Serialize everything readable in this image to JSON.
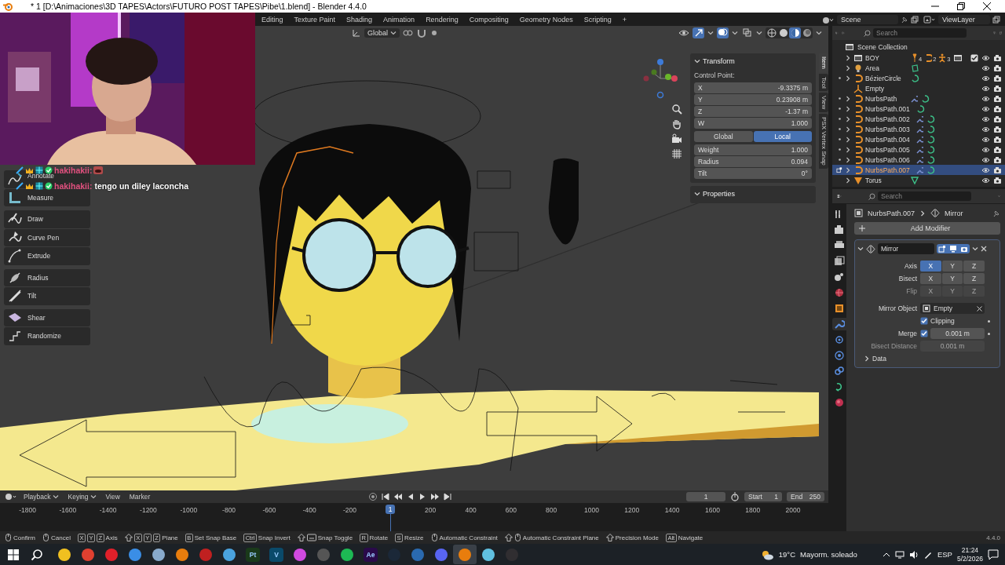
{
  "window": {
    "title": "* 1 [D:\\Animaciones\\3D TAPES\\Actors\\FUTURO POST TAPES\\Pibe\\1.blend] - Blender 4.4.0"
  },
  "workspaces": {
    "tabs": [
      {
        "label": "Editing",
        "selected": false
      },
      {
        "label": "Texture Paint",
        "selected": false
      },
      {
        "label": "Shading",
        "selected": false
      },
      {
        "label": "Animation",
        "selected": false
      },
      {
        "label": "Rendering",
        "selected": false
      },
      {
        "label": "Compositing",
        "selected": false
      },
      {
        "label": "Geometry Nodes",
        "selected": false
      },
      {
        "label": "Scripting",
        "selected": false
      }
    ],
    "add": "+"
  },
  "scene": {
    "name": "Scene"
  },
  "view_layer": {
    "name": "ViewLayer"
  },
  "chat": [
    {
      "user": "hakihakii:",
      "kind": "emote"
    },
    {
      "user": "hakihakii:",
      "kind": "text",
      "message": "tengo un diley laconcha"
    }
  ],
  "viewport": {
    "orientation": "Global",
    "toggles": [
      {
        "kind": "gizmo",
        "on": true
      },
      {
        "kind": "overlay",
        "on": true
      },
      {
        "kind": "xray",
        "on": false
      }
    ],
    "shading": [
      {
        "kind": "wireframe",
        "selected": false
      },
      {
        "kind": "solid",
        "selected": false
      },
      {
        "kind": "material",
        "selected": true
      },
      {
        "kind": "rendered",
        "selected": false
      }
    ],
    "tool_groups": [
      {
        "tools": [
          {
            "label": "Annotate"
          },
          {
            "label": "Measure"
          }
        ]
      },
      {
        "tools": [
          {
            "label": "Draw"
          },
          {
            "label": "Curve Pen"
          },
          {
            "label": "Extrude"
          }
        ]
      },
      {
        "tools": [
          {
            "label": "Radius"
          },
          {
            "label": "Tilt"
          }
        ]
      },
      {
        "tools": [
          {
            "label": "Shear"
          },
          {
            "label": "Randomize"
          }
        ]
      }
    ],
    "sidebar": {
      "tabs": [
        {
          "label": "Item",
          "selected": true
        },
        {
          "label": "Tool",
          "selected": false
        },
        {
          "label": "View",
          "selected": false
        },
        {
          "label": "PSX Vertex Snap",
          "selected": false
        }
      ],
      "panels": [
        {
          "title": "Transform",
          "expanded": true,
          "subtitle": "Control Point:",
          "rows": [
            {
              "kind": "field",
              "label": "X",
              "value": "-9.3375 m"
            },
            {
              "kind": "field",
              "label": "Y",
              "value": "0.23908 m"
            },
            {
              "kind": "field",
              "label": "Z",
              "value": "-1.37 m"
            },
            {
              "kind": "field",
              "label": "W",
              "value": "1.000"
            },
            {
              "kind": "toggle",
              "options": [
                {
                  "label": "Global",
                  "selected": false
                },
                {
                  "label": "Local",
                  "selected": true
                }
              ]
            },
            {
              "kind": "field",
              "label": "Weight",
              "value": "1.000"
            },
            {
              "kind": "field",
              "label": "Radius",
              "value": "0.094"
            },
            {
              "kind": "field",
              "label": "Tilt",
              "value": "0°"
            }
          ]
        },
        {
          "title": "Properties",
          "expanded": true
        }
      ]
    }
  },
  "timeline": {
    "menus": [
      "Playback",
      "Keying",
      "View",
      "Marker"
    ],
    "frame": "1",
    "start_label": "Start",
    "start": "1",
    "end_label": "End",
    "end": "250",
    "playhead": "1",
    "ticks": [
      "-1800",
      "-1600",
      "-1400",
      "-1200",
      "-1000",
      "-800",
      "-600",
      "-400",
      "-200",
      "200",
      "400",
      "600",
      "800",
      "1000",
      "1200",
      "1400",
      "1600",
      "1800",
      "2000"
    ]
  },
  "outliner": {
    "search_placeholder": "Search",
    "root": "Scene Collection",
    "items": [
      {
        "name": "BOY",
        "kind": "collection",
        "selected": false,
        "has_modifier": false,
        "counts": [
          "4",
          "2",
          "3"
        ],
        "checked": true
      },
      {
        "name": "Area",
        "kind": "light",
        "selected": false,
        "has_modifier": false
      },
      {
        "name": "BézierCircle",
        "kind": "curve",
        "selected": false,
        "has_modifier": false
      },
      {
        "name": "Empty",
        "kind": "empty",
        "selected": false,
        "has_modifier": false
      },
      {
        "name": "NurbsPath",
        "kind": "curve",
        "selected": false,
        "has_modifier": true
      },
      {
        "name": "NurbsPath.001",
        "kind": "curve",
        "selected": false,
        "has_modifier": false
      },
      {
        "name": "NurbsPath.002",
        "kind": "curve",
        "selected": false,
        "has_modifier": true
      },
      {
        "name": "NurbsPath.003",
        "kind": "curve",
        "selected": false,
        "has_modifier": true
      },
      {
        "name": "NurbsPath.004",
        "kind": "curve",
        "selected": false,
        "has_modifier": true
      },
      {
        "name": "NurbsPath.005",
        "kind": "curve",
        "selected": false,
        "has_modifier": true
      },
      {
        "name": "NurbsPath.006",
        "kind": "curve",
        "selected": false,
        "has_modifier": true
      },
      {
        "name": "NurbsPath.007",
        "kind": "curve",
        "selected": true,
        "has_modifier": true
      },
      {
        "name": "Torus",
        "kind": "mesh",
        "selected": false,
        "has_modifier": false
      }
    ]
  },
  "properties": {
    "search_placeholder": "Search",
    "tabs": [
      {
        "kind": "tool",
        "selected": false
      },
      {
        "kind": "render",
        "selected": false
      },
      {
        "kind": "output",
        "selected": false
      },
      {
        "kind": "view_layer",
        "selected": false
      },
      {
        "kind": "scene",
        "selected": false
      },
      {
        "kind": "world",
        "selected": false
      },
      {
        "kind": "object",
        "selected": false
      },
      {
        "kind": "modifier",
        "selected": true
      },
      {
        "kind": "particles",
        "selected": false
      },
      {
        "kind": "physics",
        "selected": false
      },
      {
        "kind": "constraints",
        "selected": false
      },
      {
        "kind": "data",
        "selected": false
      },
      {
        "kind": "material",
        "selected": false
      }
    ],
    "breadcrumb": [
      "NurbsPath.007",
      "Mirror"
    ],
    "add_modifier": "Add Modifier",
    "modifier": {
      "name": "Mirror",
      "expanded": true,
      "rows": [
        {
          "kind": "toggles",
          "label": "Axis",
          "disabled": false,
          "options": [
            {
              "label": "X",
              "selected": true
            },
            {
              "label": "Y",
              "selected": false
            },
            {
              "label": "Z",
              "selected": false
            }
          ]
        },
        {
          "kind": "toggles",
          "label": "Bisect",
          "disabled": false,
          "options": [
            {
              "label": "X",
              "selected": false
            },
            {
              "label": "Y",
              "selected": false
            },
            {
              "label": "Z",
              "selected": false
            }
          ]
        },
        {
          "kind": "toggles",
          "label": "Flip",
          "disabled": true,
          "options": [
            {
              "label": "X",
              "selected": false
            },
            {
              "label": "Y",
              "selected": false
            },
            {
              "label": "Z",
              "selected": false
            }
          ]
        },
        {
          "kind": "object",
          "label": "Mirror Object",
          "value": "Empty"
        },
        {
          "kind": "check",
          "label": "Clipping",
          "checked": true
        },
        {
          "kind": "checknum",
          "label": "Merge",
          "checked": true,
          "value": "0.001 m"
        },
        {
          "kind": "number",
          "label": "Bisect Distance",
          "value": "0.001 m",
          "disabled": true
        }
      ],
      "subpanels": [
        {
          "label": "Data",
          "expanded": false
        }
      ]
    }
  },
  "status_bar": {
    "items": [
      {
        "mouse": true,
        "label": "Confirm"
      },
      {
        "mouse": true,
        "label": "Cancel"
      },
      {
        "keys": [
          "X",
          "Y",
          "Z"
        ],
        "label": "Axis"
      },
      {
        "shift": true,
        "keys": [
          "X",
          "Y",
          "Z"
        ],
        "label": "Plane"
      },
      {
        "keys": [
          "B"
        ],
        "label": "Set Snap Base"
      },
      {
        "keys": [
          "Ctrl"
        ],
        "label": "Snap Invert"
      },
      {
        "shift": true,
        "snap": true,
        "label": "Snap Toggle"
      },
      {
        "keys": [
          "R"
        ],
        "label": "Rotate"
      },
      {
        "keys": [
          "S"
        ],
        "label": "Resize"
      },
      {
        "mouse": true,
        "label": "Automatic Constraint"
      },
      {
        "shift": true,
        "mouse": true,
        "label": "Automatic Constraint Plane"
      },
      {
        "shift": true,
        "label": "Precision Mode"
      },
      {
        "keys": [
          "Alt"
        ],
        "label": "Navigate"
      }
    ],
    "version": "4.4.0"
  },
  "taskbar": {
    "apps": [
      {
        "color": "#f0c020",
        "selected": false
      },
      {
        "color": "#e04030",
        "selected": false
      },
      {
        "color": "#e0202a",
        "selected": false
      },
      {
        "color": "#3a8ee6",
        "selected": false
      },
      {
        "color": "#88aacc",
        "selected": false
      },
      {
        "color": "#e87d0d",
        "selected": false
      },
      {
        "color": "#c02020",
        "selected": false
      },
      {
        "color": "#4aa3df",
        "selected": false
      },
      {
        "color": "#1a3a1a",
        "selected": false,
        "label": "Pt"
      },
      {
        "color": "#0a4a6a",
        "selected": false,
        "label": "V"
      },
      {
        "color": "#d04ae0",
        "selected": false
      },
      {
        "color": "#555555",
        "selected": false
      },
      {
        "color": "#1db954",
        "selected": false
      },
      {
        "color": "#2a0a4a",
        "selected": false,
        "label": "Ae"
      },
      {
        "color": "#1b2838",
        "selected": false
      },
      {
        "color": "#2a6ab0",
        "selected": false
      },
      {
        "color": "#5865f2",
        "selected": false
      },
      {
        "color": "#e87d0d",
        "selected": true
      },
      {
        "color": "#60c0e0",
        "selected": false
      },
      {
        "color": "#302e31",
        "selected": false
      }
    ],
    "temperature": "19°C",
    "weather": "Mayorm. soleado",
    "language": "ESP",
    "time": "21:24",
    "date": "5/2/2026"
  }
}
